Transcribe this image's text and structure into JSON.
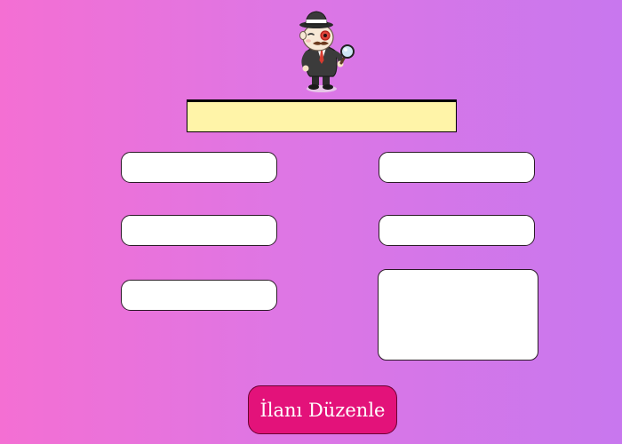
{
  "mascot": {
    "icon": "detective-mascot-icon"
  },
  "header": {
    "title_text": ""
  },
  "form": {
    "field_1": {
      "value": "",
      "placeholder": ""
    },
    "field_2": {
      "value": "",
      "placeholder": ""
    },
    "field_3": {
      "value": "",
      "placeholder": ""
    },
    "field_4": {
      "value": "",
      "placeholder": ""
    },
    "field_5": {
      "value": "",
      "placeholder": ""
    },
    "description": {
      "value": "",
      "placeholder": ""
    }
  },
  "actions": {
    "edit_label": "İlanı Düzenle"
  },
  "colors": {
    "background_start": "#f46fd3",
    "background_end": "#c877ee",
    "title_bar": "#fff4a8",
    "button": "#e3127a"
  }
}
